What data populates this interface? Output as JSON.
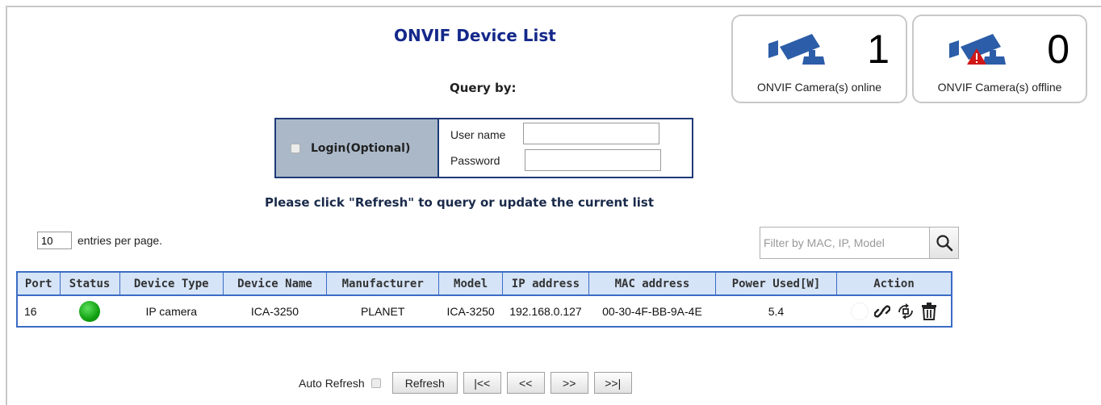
{
  "page": {
    "title": "ONVIF Device List",
    "query_by": "Query by:",
    "hint": "Please click \"Refresh\" to query or update the current list"
  },
  "stats": {
    "online": {
      "count": "1",
      "label": "ONVIF Camera(s) online"
    },
    "offline": {
      "count": "0",
      "label": "ONVIF Camera(s) offline"
    }
  },
  "login": {
    "label": "Login(Optional)",
    "checked": false,
    "username_label": "User name",
    "username_value": "",
    "password_label": "Password",
    "password_value": ""
  },
  "pagination": {
    "entries_value": "10",
    "entries_label": "entries per page."
  },
  "filter": {
    "placeholder": "Filter by MAC, IP, Model",
    "value": ""
  },
  "table": {
    "headers": [
      "Port",
      "Status",
      "Device Type",
      "Device Name",
      "Manufacturer",
      "Model",
      "IP address",
      "MAC address",
      "Power Used[W]",
      "Action"
    ],
    "rows": [
      {
        "port": "16",
        "status": "online",
        "device_type": "IP camera",
        "device_name": "ICA-3250",
        "manufacturer": "PLANET",
        "model": "ICA-3250",
        "ip": "192.168.0.127",
        "mac": "00-30-4F-BB-9A-4E",
        "power": "5.4"
      }
    ]
  },
  "bottom": {
    "auto_refresh_label": "Auto Refresh",
    "auto_refresh_checked": false,
    "refresh": "Refresh",
    "first": "|<<",
    "prev": "<<",
    "next": ">>",
    "last": ">>|"
  },
  "colors": {
    "title": "#14288a",
    "table_border": "#3b6cc4",
    "table_header_bg": "#d5e4f7",
    "login_left_bg": "#aab8c8",
    "status_online": "#10a010",
    "camera_icon": "#2c5da8",
    "warning": "#d01818"
  }
}
